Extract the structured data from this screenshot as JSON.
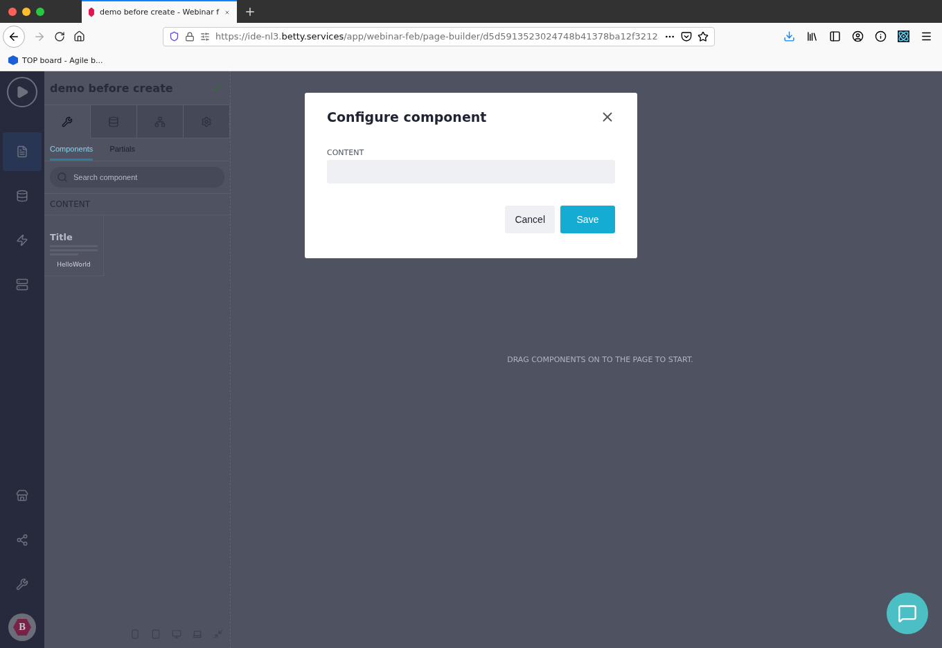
{
  "browser": {
    "tab": {
      "title": "demo before create - Webinar f",
      "selected": true
    },
    "url": {
      "prefix": "https://ide-nl3.",
      "domain": "betty.services",
      "path": "/app/webinar-feb/page-builder/d5d5913523024748b41378ba12f3212"
    },
    "bookmarks": [
      "TOP board - Agile b..."
    ]
  },
  "rail": [
    {
      "kind": "page",
      "selected": true
    },
    {
      "kind": "data",
      "selected": false
    },
    {
      "kind": "actions",
      "selected": false
    },
    {
      "kind": "models",
      "selected": false
    }
  ],
  "rail_bottom": [
    {
      "kind": "store"
    },
    {
      "kind": "share"
    },
    {
      "kind": "tools"
    }
  ],
  "logo_letter": "B",
  "panel": {
    "title": "demo before create",
    "tool_tabs": [
      {
        "kind": "tools",
        "selected": true
      },
      {
        "kind": "data",
        "selected": false
      },
      {
        "kind": "tree",
        "selected": false
      },
      {
        "kind": "settings",
        "selected": false
      }
    ],
    "tabs": [
      {
        "label": "Components",
        "selected": true
      },
      {
        "label": "Partials",
        "selected": false
      }
    ],
    "search": {
      "placeholder": "Search component"
    },
    "category": "CONTENT",
    "components": [
      {
        "preview_title": "Title",
        "name": "HelloWorld"
      }
    ]
  },
  "canvas": {
    "hint": "DRAG COMPONENTS ON TO THE PAGE TO START."
  },
  "dialog": {
    "title": "Configure component",
    "field_label": "CONTENT",
    "buttons": [
      {
        "label": "Cancel",
        "kind": "secondary"
      },
      {
        "label": "Save",
        "kind": "primary"
      }
    ]
  }
}
